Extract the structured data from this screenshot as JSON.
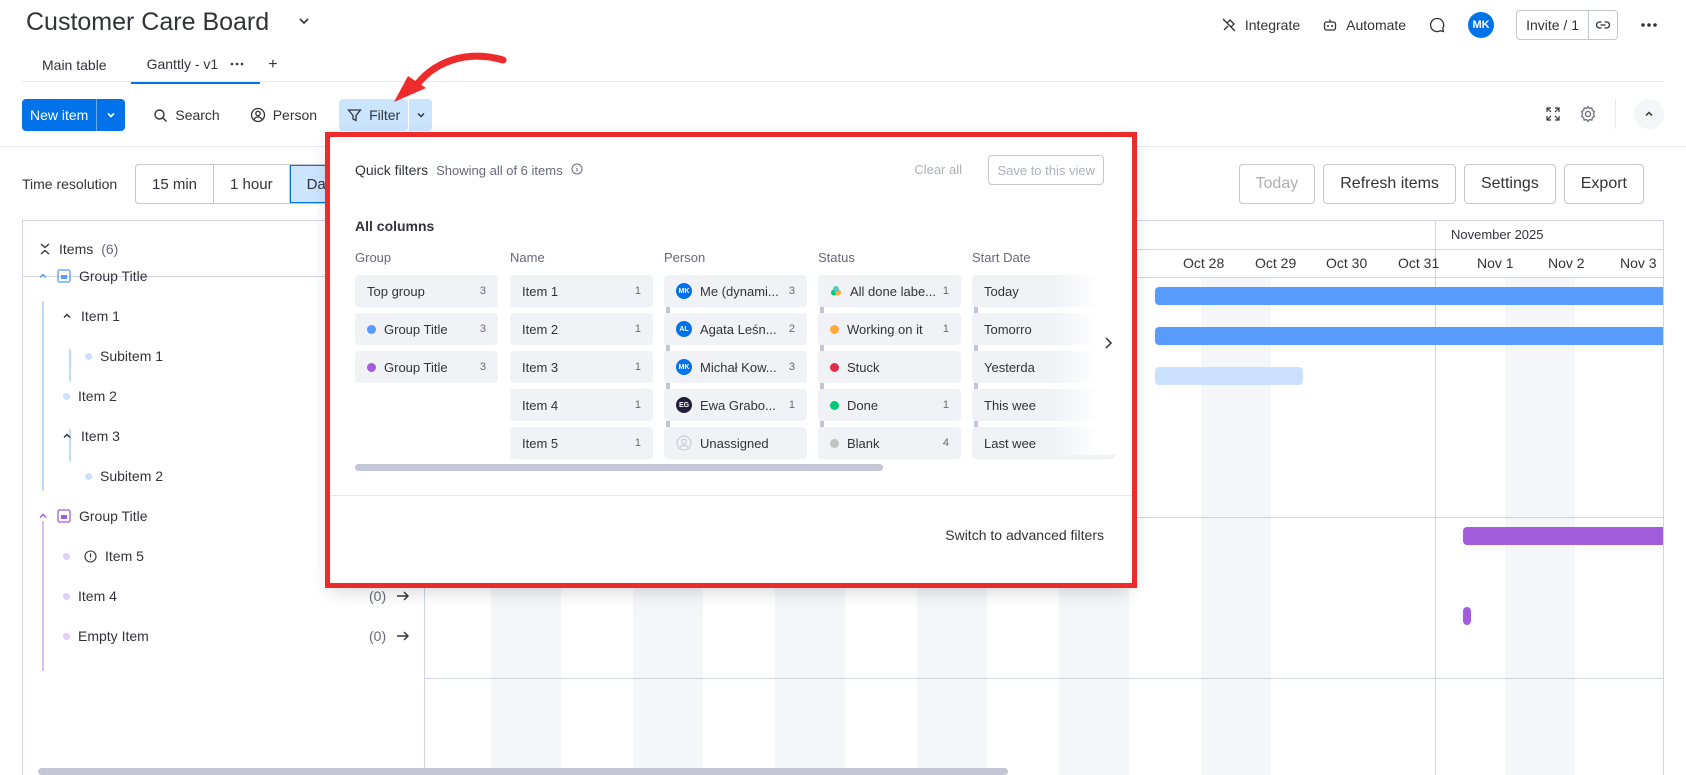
{
  "board": {
    "title": "Customer Care Board"
  },
  "top_actions": {
    "integrate": "Integrate",
    "automate": "Automate",
    "avatar_initials": "MK",
    "invite": "Invite / 1"
  },
  "tabs": [
    {
      "label": "Main table"
    },
    {
      "label": "Ganttly - v1"
    }
  ],
  "toolbar": {
    "new_item": "New item",
    "search": "Search",
    "person": "Person",
    "filter": "Filter"
  },
  "time_resolution": {
    "label": "Time resolution",
    "options": [
      "15 min",
      "1 hour",
      "Da"
    ]
  },
  "gantt_buttons": {
    "today": "Today",
    "refresh": "Refresh items",
    "settings": "Settings",
    "export": "Export"
  },
  "items_panel": {
    "header": "Items",
    "count": "(6)",
    "rows": [
      {
        "label": "Group Title"
      },
      {
        "label": "Item 1"
      },
      {
        "label": "Subitem 1"
      },
      {
        "label": "Item 2"
      },
      {
        "label": "Item 3"
      },
      {
        "label": "Subitem 2"
      },
      {
        "label": "Group Title"
      },
      {
        "label": "Item 5"
      },
      {
        "label": "Item 4",
        "count": "(0)"
      },
      {
        "label": "Empty Item",
        "count": "(0)"
      }
    ]
  },
  "timeline": {
    "month": "November 2025",
    "days": [
      "Oct 28",
      "Oct 29",
      "Oct 30",
      "Oct 31",
      "Nov 1",
      "Nov 2",
      "Nov 3"
    ]
  },
  "quick_filters": {
    "title": "Quick filters",
    "showing": "Showing all of 6 items",
    "clear_all": "Clear all",
    "save": "Save to this view",
    "all_columns": "All columns",
    "advanced": "Switch to advanced filters",
    "group": {
      "header": "Group",
      "chips": [
        {
          "label": "Top group",
          "count": "3"
        },
        {
          "label": "Group Title",
          "count": "3",
          "color": "#579bfc"
        },
        {
          "label": "Group Title",
          "count": "3",
          "color": "#a25ddc"
        }
      ]
    },
    "name": {
      "header": "Name",
      "chips": [
        {
          "label": "Item 1",
          "count": "1"
        },
        {
          "label": "Item 2",
          "count": "1"
        },
        {
          "label": "Item 3",
          "count": "1"
        },
        {
          "label": "Item 4",
          "count": "1"
        },
        {
          "label": "Item 5",
          "count": "1"
        }
      ]
    },
    "person": {
      "header": "Person",
      "chips": [
        {
          "label": "Me (dynami...",
          "count": "3",
          "initials": "MK"
        },
        {
          "label": "Agata Leśn...",
          "count": "2",
          "initials": "AL"
        },
        {
          "label": "Michał Kow...",
          "count": "3",
          "initials": "MK"
        },
        {
          "label": "Ewa Grabo...",
          "count": "1",
          "initials": "EG"
        },
        {
          "label": "Unassigned",
          "count": ""
        }
      ]
    },
    "status": {
      "header": "Status",
      "chips": [
        {
          "label": "All done labe...",
          "count": "1"
        },
        {
          "label": "Working on it",
          "count": "1",
          "color": "#fdab3d"
        },
        {
          "label": "Stuck",
          "count": "",
          "color": "#df2f4a"
        },
        {
          "label": "Done",
          "count": "1",
          "color": "#00c875"
        },
        {
          "label": "Blank",
          "count": "4",
          "color": "#c4c4c4"
        }
      ]
    },
    "start_date": {
      "header": "Start Date",
      "chips": [
        {
          "label": "Today"
        },
        {
          "label": "Tomorro"
        },
        {
          "label": "Yesterda"
        },
        {
          "label": "This wee"
        },
        {
          "label": "Last wee"
        }
      ]
    }
  },
  "colors": {
    "primary": "#0073ea",
    "highlight": "#ee2b2b",
    "group1": "#579bfc",
    "group2": "#a25ddc"
  }
}
